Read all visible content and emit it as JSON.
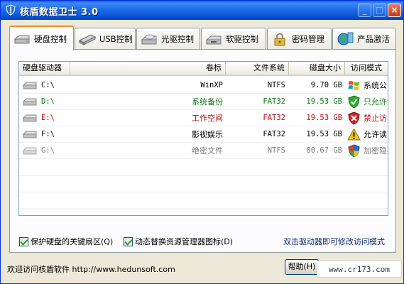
{
  "window": {
    "title": "核盾数据卫士 3.0",
    "controls": [
      "_",
      "□",
      "×"
    ]
  },
  "tabs": [
    {
      "label": "硬盘控制",
      "icon": "hard-disk-icon",
      "active": true
    },
    {
      "label": "USB控制",
      "icon": "usb-drive-icon",
      "active": false
    },
    {
      "label": "光驱控制",
      "icon": "optical-drive-icon",
      "active": false
    },
    {
      "label": "软驱控制",
      "icon": "floppy-drive-icon",
      "active": false
    },
    {
      "label": "密码管理",
      "icon": "padlock-icon",
      "active": false
    },
    {
      "label": "产品激活",
      "icon": "globe-activation-icon",
      "active": false
    }
  ],
  "list": {
    "headers": [
      "硬盘驱动器",
      "卷标",
      "文件系统",
      "磁盘大小",
      "访问模式"
    ],
    "rows": [
      {
        "drive": "C:\\",
        "label": "WinXP",
        "fs": "NTFS",
        "size": "9.70 GB",
        "mode": "系统公区",
        "mode_icon": "windows-flag-icon",
        "color": "#000000"
      },
      {
        "drive": "D:\\",
        "label": "系统备份",
        "fs": "FAT32",
        "size": "19.53 GB",
        "mode": "只允许读",
        "mode_icon": "green-shield-check-icon",
        "color": "#0b7a10"
      },
      {
        "drive": "E:\\",
        "label": "工作空间",
        "fs": "FAT32",
        "size": "19.53 GB",
        "mode": "禁止访问",
        "mode_icon": "red-x-icon",
        "color": "#b31010"
      },
      {
        "drive": "F:\\",
        "label": "影视娱乐",
        "fs": "FAT32",
        "size": "19.53 GB",
        "mode": "允许读写",
        "mode_icon": "warning-triangle-icon",
        "color": "#000000"
      },
      {
        "drive": "G:\\",
        "label": "绝密文件",
        "fs": "NTFS",
        "size": "80.67 GB",
        "mode": "加密隐藏",
        "mode_icon": "security-shield-icon",
        "color": "#7a7a7a"
      }
    ]
  },
  "options": {
    "protect_boot": "保护硬盘的关键扇区(Q)",
    "replace_icon": "动态替换资源管理器图标(D)",
    "hint": "双击驱动器即可修改访问模式"
  },
  "footer": {
    "status": "欢迎访问核盾软件 http://www.hedunsoft.com",
    "help_button": "帮助(H)",
    "watermark": "www.cr173.com"
  }
}
